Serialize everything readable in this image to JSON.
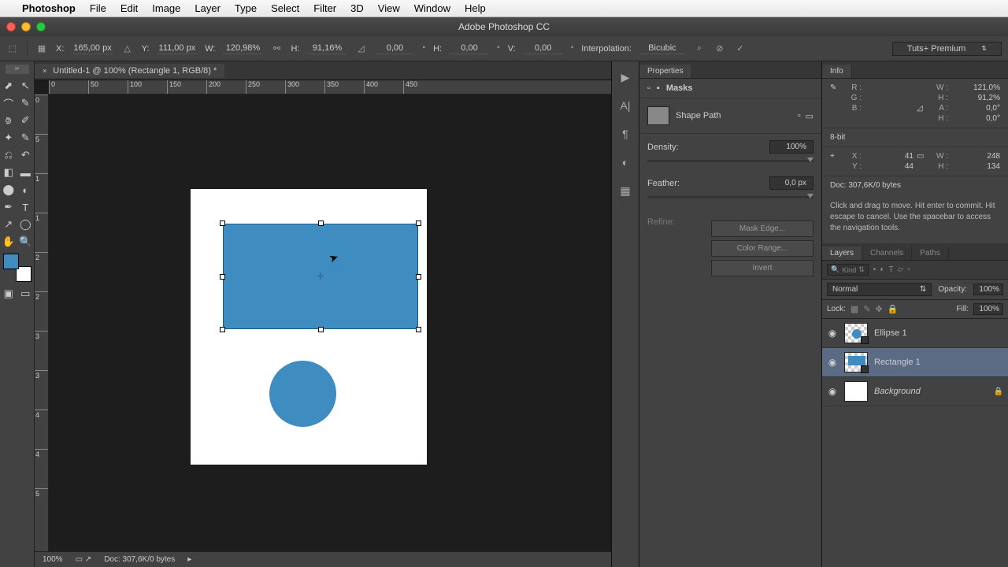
{
  "menubar": {
    "app": "Photoshop",
    "items": [
      "File",
      "Edit",
      "Image",
      "Layer",
      "Type",
      "Select",
      "Filter",
      "3D",
      "View",
      "Window",
      "Help"
    ]
  },
  "titlebar": {
    "title": "Adobe Photoshop CC"
  },
  "options": {
    "x_lbl": "X:",
    "x": "165,00 px",
    "y_lbl": "Y:",
    "y": "111,00 px",
    "w_lbl": "W:",
    "w": "120,98%",
    "h_lbl": "H:",
    "h": "91,16%",
    "angle": "0,00",
    "h2_lbl": "H:",
    "h2": "0,00",
    "v_lbl": "V:",
    "v": "0,00",
    "interp_lbl": "Interpolation:",
    "interp": "Bicubic",
    "preset": "Tuts+ Premium"
  },
  "doc": {
    "tab": "Untitled-1 @ 100% (Rectangle 1, RGB/8) *",
    "zoom": "100%",
    "docinfo": "Doc: 307,6K/0 bytes"
  },
  "ruler_top": [
    "0",
    "50",
    "100",
    "150",
    "200",
    "250",
    "300",
    "350",
    "400",
    "450"
  ],
  "ruler_left": [
    "0",
    "5",
    "1",
    "1",
    "2",
    "2",
    "3",
    "3",
    "4",
    "4",
    "5"
  ],
  "properties": {
    "tab": "Properties",
    "masks": "Masks",
    "shape_path": "Shape Path",
    "density_lbl": "Density:",
    "density": "100%",
    "feather_lbl": "Feather:",
    "feather": "0,0 px",
    "refine_lbl": "Refine:",
    "mask_edge": "Mask Edge...",
    "color_range": "Color Range...",
    "invert": "Invert"
  },
  "info": {
    "tab": "Info",
    "r": "R :",
    "g": "G :",
    "b": "B :",
    "w_lbl": "W :",
    "w": "121,0%",
    "h_lbl": "H :",
    "h": "91,2%",
    "a_lbl": "A :",
    "a": "0,0°",
    "h2_lbl": "H :",
    "h2": "0,0°",
    "bit": "8-bit",
    "x_lbl": "X :",
    "x": "41",
    "y_lbl": "Y :",
    "y": "44",
    "w2_lbl": "W :",
    "w2": "248",
    "h3_lbl": "H :",
    "h3": "134",
    "doc": "Doc: 307,6K/0 bytes",
    "hint": "Click and drag to move. Hit enter to commit. Hit escape to cancel. Use the spacebar to access the navigation tools."
  },
  "layers": {
    "tabs": [
      "Layers",
      "Channels",
      "Paths"
    ],
    "kind": "Kind",
    "blend": "Normal",
    "opacity_lbl": "Opacity:",
    "opacity": "100%",
    "lock_lbl": "Lock:",
    "fill_lbl": "Fill:",
    "fill": "100%",
    "items": [
      {
        "name": "Ellipse 1"
      },
      {
        "name": "Rectangle 1"
      },
      {
        "name": "Background"
      }
    ]
  }
}
